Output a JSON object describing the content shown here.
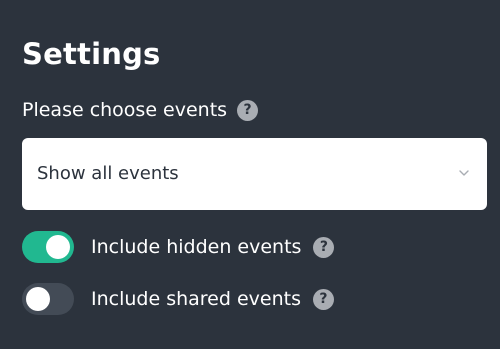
{
  "settings": {
    "title": "Settings",
    "events_label": "Please choose events",
    "events_help_icon": "question-mark-icon",
    "events_select": {
      "selected_value": "Show all events",
      "chevron_icon": "chevron-down-icon"
    },
    "toggles": [
      {
        "label": "Include hidden events",
        "checked": true,
        "help_icon": "question-mark-icon"
      },
      {
        "label": "Include shared events",
        "checked": false,
        "help_icon": "question-mark-icon"
      }
    ]
  },
  "help_glyph": "?",
  "colors": {
    "background": "#2c333d",
    "toggle_on": "#21b890",
    "toggle_off": "#434b56",
    "help_icon": "#a9adb3",
    "select_bg": "#ffffff"
  }
}
